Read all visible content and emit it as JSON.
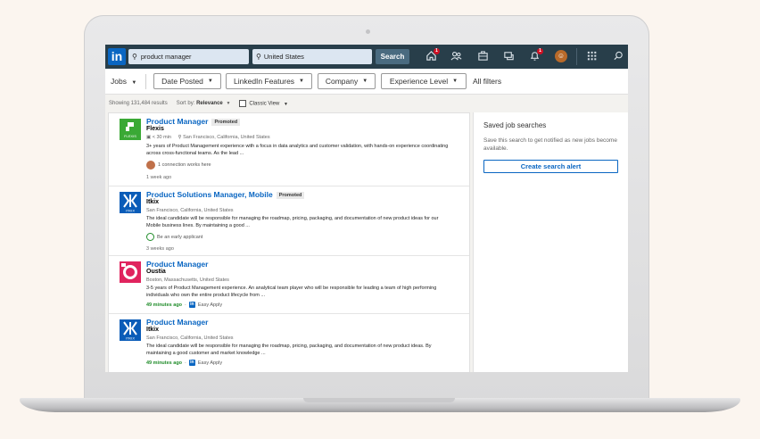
{
  "nav": {
    "logo_text": "in",
    "search_value": "product manager",
    "location_value": "United States",
    "search_button": "Search",
    "home_badge": "1",
    "notif_badge": "1"
  },
  "filters": {
    "jobs": "Jobs",
    "date_posted": "Date Posted",
    "linkedin_features": "LinkedIn Features",
    "company": "Company",
    "experience_level": "Experience Level",
    "all_filters": "All filters"
  },
  "results": {
    "count": "Showing 131,484 results",
    "sort_label": "Sort by:",
    "sort_value": "Relevance",
    "view": "Classic View"
  },
  "jobs": [
    {
      "title": "Product Manager",
      "badge": "Promoted",
      "company": "Flexis",
      "logo_text": "FLEXIS",
      "commute": "< 30 min",
      "location": "San Francisco, California, United States",
      "description": "3+ years of Product Management experience with a focus in data analytics and customer validation, with hands-on experience coordinating across cross-functional teams. As the lead ...",
      "extra": "1 connection works here",
      "time": "1 week ago"
    },
    {
      "title": "Product Solutions Manager, Mobile",
      "badge": "Promoted",
      "company": "Itkix",
      "logo_text": "ITKIX",
      "location": "San Francisco, California, United States",
      "description": "The ideal candidate will be responsible for managing the roadmap, pricing, packaging, and documentation of new product ideas for our Mobile business lines. By maintaining a good ...",
      "extra": "Be an early applicant",
      "time": "3 weeks ago"
    },
    {
      "title": "Product Manager",
      "company": "Oustia",
      "location": "Boston, Massachusetts, United States",
      "description": "3-5 years of Product Management experience. An analytical team player who will be responsible for leading a team of high performing individuals who own the entire product lifecycle from ...",
      "time": "49 minutes ago",
      "easy_apply": "Easy Apply"
    },
    {
      "title": "Product Manager",
      "company": "Itkix",
      "logo_text": "ITKIX",
      "location": "San Francisco, California, United States",
      "description": "The ideal candidate will be responsible for managing the roadmap, pricing, packaging, and documentation of new product ideas. By maintaining a good customer and market knowledge ...",
      "time": "49 minutes ago",
      "easy_apply": "Easy Apply"
    }
  ],
  "side": {
    "title": "Saved job searches",
    "description": "Save this search to get notified as new jobs become available.",
    "button": "Create search alert"
  },
  "colors": {
    "nav_bg": "#283e4a",
    "brand_blue": "#0a66c2",
    "flexis_green": "#3aa935",
    "oustia_red": "#e0245e",
    "easy_green": "#208c2a"
  }
}
